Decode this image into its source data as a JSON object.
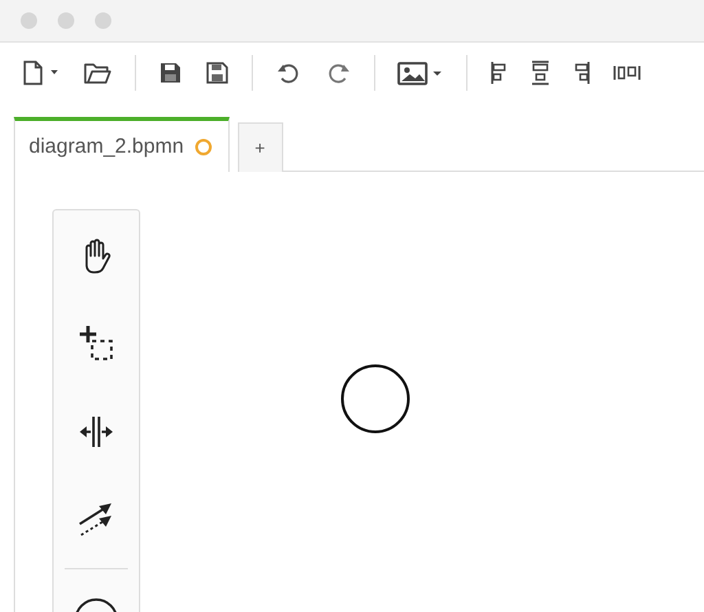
{
  "tabs": [
    {
      "label": "diagram_2.bpmn",
      "selected": true,
      "unsaved": true
    }
  ],
  "new_tab": {
    "label": "+"
  }
}
